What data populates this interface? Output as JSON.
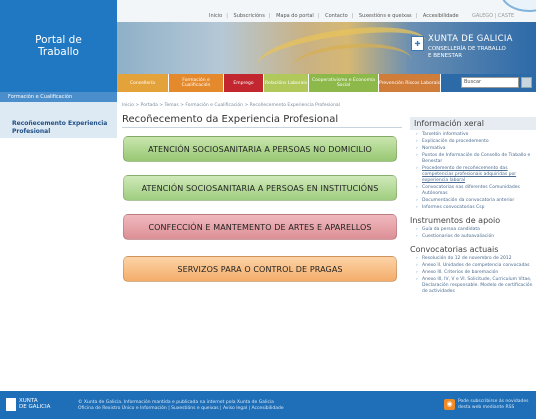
{
  "portal": {
    "line1": "Portal de",
    "line2": "Traballo"
  },
  "top_links": [
    "Inicio",
    "Subscricións",
    "Mapa do portal",
    "Contacto",
    "Suxestións e queixas",
    "Accesibilidade"
  ],
  "lang": "GALEGO | CASTE",
  "brand": {
    "emblem": "✚",
    "name": "XUNTA DE GALICIA",
    "dept_line1": "CONSELLERÍA DE TRABALLO",
    "dept_line2": "E BENESTAR"
  },
  "nav": {
    "tabs": [
      {
        "label": "Consellería",
        "color": "#e4a23a"
      },
      {
        "label": "Formación e Cualificación",
        "color": "#e58a2c"
      },
      {
        "label": "Emprego",
        "color": "#c2262e"
      },
      {
        "label": "Relacións Laborais",
        "color": "#b0c95a"
      },
      {
        "label": "Cooperativismo e Economía Social",
        "color": "#8db84a"
      },
      {
        "label": "Prevención Riscos Laborais",
        "color": "#d17d3a"
      }
    ],
    "search_placeholder": "Buscar"
  },
  "sidebar": {
    "section": "Formación e Cualificación",
    "item": "Recoñecemento Experiencia Profesional"
  },
  "breadcrumb": "Inicio > Portada > Temas > Formación e Cualificación > Recoñecemento Experiencia Profesional",
  "page_title": "Recoñecemento da Experiencia Profesional",
  "buttons": [
    "ATENCIÓN SOCIOSANITARIA A PERSOAS NO DOMICILIO",
    "ATENCIÓN SOCIOSANITARIA A PERSOAS EN INSTITUCIÓNS",
    "CONFECCIÓN E MANTEMENTO DE ARTES E APARELLOS",
    "SERVIZOS PARA O CONTROL DE PRAGAS"
  ],
  "right": {
    "info_title": "Información xeral",
    "info_items": [
      "Tarxetón informativo",
      "Explicación do procedemento",
      "Normativa",
      "Puntos de Información do Consello de Traballo e Benestar",
      "Procedemento de recoñecemento das competencias profesionais adquiridas por experiencia laboral",
      "Convocatorias nas diferentes Comunidades Autónomas",
      "Documentación da convocatoria anterior",
      "Informes convocatorias Csp"
    ],
    "tools_title": "Instrumentos de apoio",
    "tools_items": [
      "Guía da persoa candidata",
      "Cuestionarios de autoavaliación"
    ],
    "calls_title": "Convocatorias actuais",
    "calls_items": [
      "Resolución do 12 de novembro de 2012",
      "Anexo II. Unidades de competencia convocadas",
      "Anexo III. Criterios de baremación",
      "Anexo III, IV, V e VI. Solicitude, Curriculum Vitae, Declaración responsable. Modelo de certificación de actividades"
    ]
  },
  "footer": {
    "logo_line1": "XUNTA",
    "logo_line2": "DE GALICIA",
    "text_line1": "© Xunta de Galicia. Información mantida e publicada na internet pola Xunta de Galicia",
    "text_line2": "Oficina de Rexistro Único e Información | Suxestións e queixas | Aviso legal | Accesibilidade",
    "rss_glyph": "◉",
    "rss_line1": "Pode subscribirse ás novidades",
    "rss_line2": "desta web mediante RSS"
  }
}
